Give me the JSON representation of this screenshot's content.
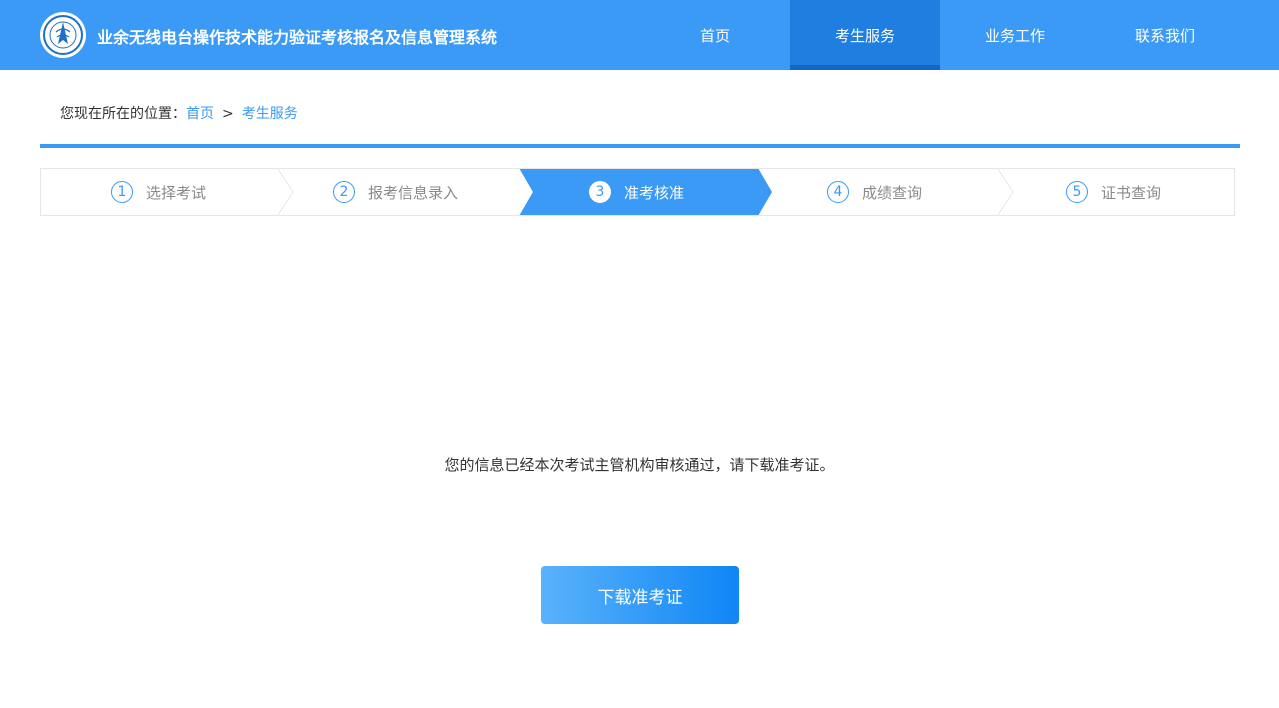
{
  "header": {
    "logo_icon": "radio-association-emblem-icon",
    "title": "业余无线电台操作技术能力验证考核报名及信息管理系统",
    "nav": [
      {
        "label": "首页",
        "active": false
      },
      {
        "label": "考生服务",
        "active": true
      },
      {
        "label": "业务工作",
        "active": false
      },
      {
        "label": "联系我们",
        "active": false
      }
    ]
  },
  "breadcrumb": {
    "prefix": "您现在所在的位置：",
    "items": [
      "首页",
      "考生服务"
    ],
    "separator": ">"
  },
  "steps": [
    {
      "num": "1",
      "label": "选择考试",
      "active": false
    },
    {
      "num": "2",
      "label": "报考信息录入",
      "active": false
    },
    {
      "num": "3",
      "label": "准考核准",
      "active": true
    },
    {
      "num": "4",
      "label": "成绩查询",
      "active": false
    },
    {
      "num": "5",
      "label": "证书查询",
      "active": false
    }
  ],
  "main": {
    "message": "您的信息已经本次考试主管机构审核通过，请下载准考证。",
    "download_button": "下载准考证"
  },
  "colors": {
    "primary": "#3a9af5",
    "nav_active": "#1f7ee0",
    "step_inactive_text": "#8a8a8a"
  }
}
